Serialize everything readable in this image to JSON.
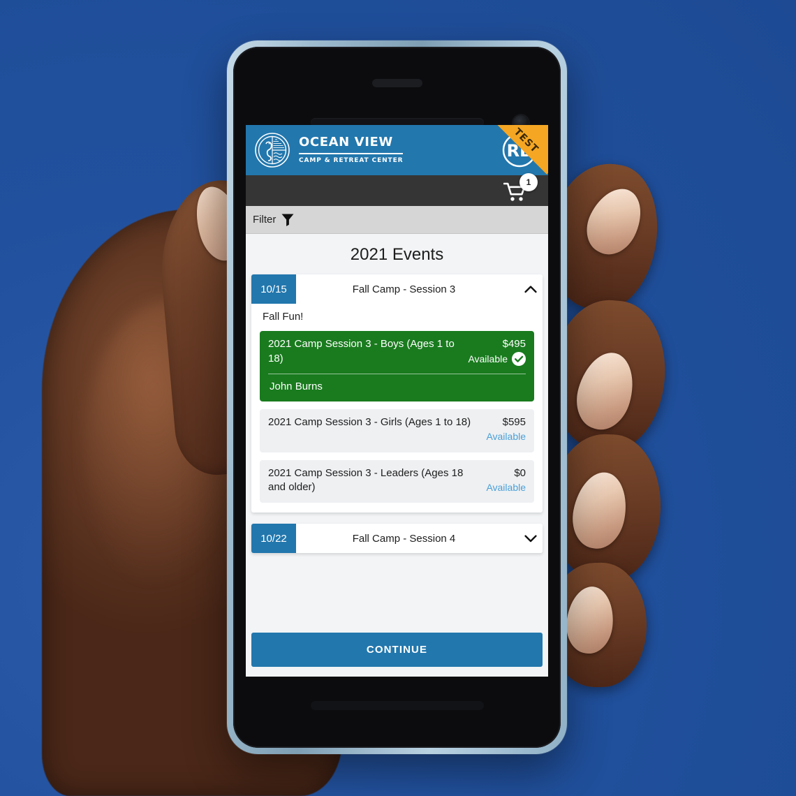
{
  "brand": {
    "name": "OCEAN VIEW",
    "tagline": "CAMP & RETREAT CENTER",
    "logo_icon": "ocean-view-seahorse-emblem-icon",
    "rb_badge_text": "RB",
    "ribbon_label": "TEST"
  },
  "cart": {
    "icon": "shopping-cart-icon",
    "count": "1"
  },
  "filter": {
    "label": "Filter",
    "icon": "funnel-filter-icon"
  },
  "page": {
    "title": "2021 Events",
    "background_color": "#f2f4f6",
    "accent_color": "#2277ad",
    "selected_color": "#197b1e",
    "link_color": "#4a9fd8"
  },
  "events": [
    {
      "date": "10/15",
      "name": "Fall Camp - Session 3",
      "expanded": true,
      "chevron_icon": "chevron-up-icon",
      "note": "Fall Fun!",
      "options": [
        {
          "name": "2021 Camp Session 3 - Boys (Ages 1 to 18)",
          "price": "$495",
          "availability": "Available",
          "selected": true,
          "check_icon": "check-circle-icon",
          "attendee": "John Burns"
        },
        {
          "name": "2021 Camp Session 3 - Girls (Ages 1 to 18)",
          "price": "$595",
          "availability": "Available",
          "selected": false
        },
        {
          "name": "2021 Camp Session 3 - Leaders (Ages 18 and older)",
          "price": "$0",
          "availability": "Available",
          "selected": false
        }
      ]
    },
    {
      "date": "10/22",
      "name": "Fall Camp - Session 4",
      "expanded": false,
      "chevron_icon": "chevron-down-icon"
    }
  ],
  "footer": {
    "continue_label": "CONTINUE"
  }
}
